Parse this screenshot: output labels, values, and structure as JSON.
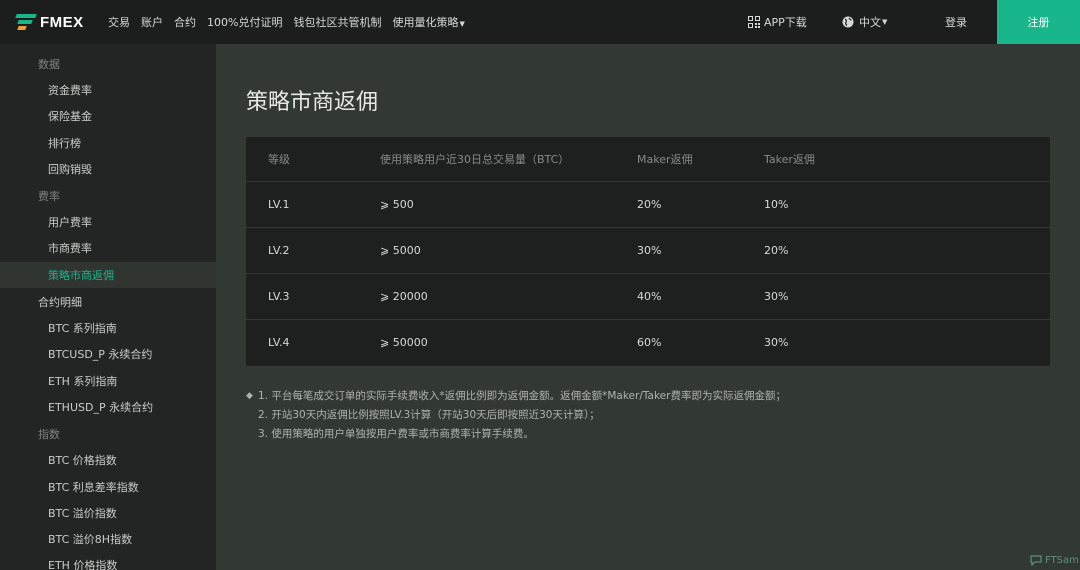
{
  "header": {
    "logo_text": "FMEX",
    "nav": [
      {
        "label": "交易"
      },
      {
        "label": "账户"
      },
      {
        "label": "合约"
      },
      {
        "label": "100%兑付证明"
      },
      {
        "label": "钱包社区共管机制"
      },
      {
        "label": "使用量化策略",
        "has_dropdown": true
      }
    ],
    "app_download": "APP下载",
    "language": "中文",
    "login": "登录",
    "register": "注册"
  },
  "sidebar": {
    "sections": [
      {
        "title": "数据",
        "items": [
          "资金费率",
          "保险基金",
          "排行榜",
          "回购销毁"
        ]
      },
      {
        "title": "费率",
        "items": [
          "用户费率",
          "市商费率",
          "策略市商返佣"
        ]
      },
      {
        "title": "合约明细",
        "items": [
          "BTC 系列指南",
          "BTCUSD_P 永续合约",
          "ETH 系列指南",
          "ETHUSD_P 永续合约"
        ]
      },
      {
        "title": "指数",
        "items": [
          "BTC 价格指数",
          "BTC 利息差率指数",
          "BTC 溢价指数",
          "BTC 溢价8H指数",
          "ETH 价格指数"
        ]
      }
    ],
    "active_item": "策略市商返佣"
  },
  "main": {
    "title": "策略市商返佣",
    "table": {
      "headers": [
        "等级",
        "使用策略用户近30日总交易量（BTC）",
        "Maker返佣",
        "Taker返佣"
      ],
      "rows": [
        [
          "LV.1",
          "⩾ 500",
          "20%",
          "10%"
        ],
        [
          "LV.2",
          "⩾ 5000",
          "30%",
          "20%"
        ],
        [
          "LV.3",
          "⩾ 20000",
          "40%",
          "30%"
        ],
        [
          "LV.4",
          "⩾ 50000",
          "60%",
          "30%"
        ]
      ]
    },
    "notes": [
      "1. 平台每笔成交订单的实际手续费收入*返佣比例即为返佣金额。返佣金额*Maker/Taker费率即为实际返佣金额；",
      "2. 开站30天内返佣比例按照LV.3计算（开站30天后即按照近30天计算）；",
      "3. 使用策略的用户单独按用户费率或市商费率计算手续费。"
    ]
  },
  "watermark": "FTSam",
  "colors": {
    "accent": "#19b58b",
    "topbar_bg": "#1b1e1d",
    "sidebar_bg": "#222523",
    "main_bg": "#323834",
    "table_bg": "#1d201f"
  },
  "icons": {
    "app_download": "qr-code-icon",
    "language": "globe-icon",
    "notes_bullet": "diamond-icon"
  }
}
